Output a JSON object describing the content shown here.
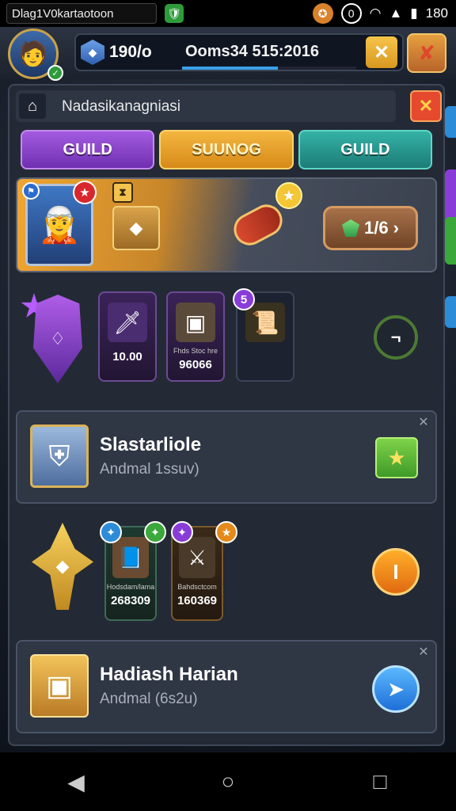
{
  "status_bar": {
    "title": "Dlag1V0kartaotoon",
    "time": "180",
    "icons": [
      "app-icon",
      "medal-icon",
      "alarm-icon",
      "wifi-icon",
      "signal-icon",
      "battery-icon"
    ]
  },
  "top_bar": {
    "gem_count": "190/o",
    "timer_text": "Ooms34 515:2016",
    "progress_fraction": 0.55,
    "close_label": "✕"
  },
  "breadcrumb": {
    "text": "Nadasikanagniasi",
    "close_label": "✕"
  },
  "tabs": [
    {
      "label": "GUILD",
      "color": "#8e44d6"
    },
    {
      "label": "SUUNOG",
      "color": "#e9a42a"
    },
    {
      "label": "GUILD",
      "color": "#26a095"
    }
  ],
  "hero_card": {
    "progress_text": "1/6",
    "chest_tag": "⧗",
    "star": "★"
  },
  "row1": {
    "slots": [
      {
        "caption": "",
        "value": "10.00"
      },
      {
        "caption": "Fhds Stoc hre",
        "value": "96066"
      },
      {
        "caption": "",
        "value": "",
        "badge": "5"
      }
    ],
    "action_label": "¬"
  },
  "card_a": {
    "title": "Slastarliole",
    "subtitle": "Andmal 1ssuv)"
  },
  "row2": {
    "slots": [
      {
        "caption": "Hodsdam/lama",
        "value": "268309"
      },
      {
        "caption": "Bahdsctcom",
        "value": "160369"
      }
    ],
    "action_label": "I"
  },
  "card_b": {
    "title": "Hadiash Harian",
    "subtitle": "Andmal (6s2u)"
  },
  "nav": {
    "back": "◀",
    "home": "○",
    "recents": "□"
  },
  "colors": {
    "accent_orange": "#f0a632",
    "panel": "#232a35",
    "purple": "#8e44d6",
    "teal": "#26a095"
  }
}
